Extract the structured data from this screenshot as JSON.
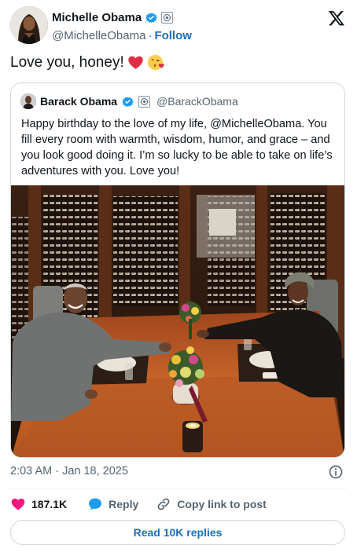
{
  "author": {
    "name": "Michelle Obama",
    "handle": "@MichelleObama",
    "separator": "·",
    "follow_label": "Follow"
  },
  "post": {
    "text": "Love you, honey!",
    "emojis": [
      "red-heart",
      "face-blowing-kiss"
    ]
  },
  "quoted": {
    "name": "Barack Obama",
    "handle": "@BarackObama",
    "text": "Happy birthday to the love of my life, @MichelleObama. You fill every room with warmth, wisdom, humor, and grace – and you look good doing it. I’m so lucky to be able to take on life’s adventures with you. Love you!"
  },
  "timestamp": "2:03 AM · Jan 18, 2025",
  "actions": {
    "likes": "187.1K",
    "reply": "Reply",
    "copy_link": "Copy link to post"
  },
  "read_replies": "Read 10K replies",
  "icons": {
    "verified": "verified-badge-icon",
    "government": "government-seal-icon",
    "platform": "x-logo-icon",
    "info": "info-icon",
    "like": "heart-icon",
    "reply": "speech-bubble-icon",
    "link": "link-icon"
  },
  "colors": {
    "text": "#0f1419",
    "secondary": "#536471",
    "link": "#1d6fb8",
    "verified": "#1d9bf0",
    "like": "#f91880",
    "border": "#cfd9de"
  }
}
